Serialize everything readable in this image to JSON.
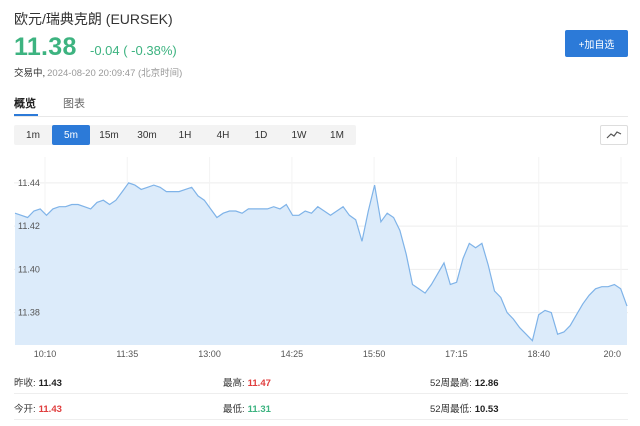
{
  "header": {
    "title": "欧元/瑞典克朗 (EURSEK)",
    "price": "11.38",
    "change": "-0.04 ( -0.38%)",
    "status": "交易中,",
    "time": "2024-08-20 20:09:47 (北京时间)",
    "watch_label": "+加自选"
  },
  "view_tabs": [
    {
      "label": "概览",
      "active": true
    },
    {
      "label": "图表",
      "active": false
    }
  ],
  "intervals": [
    {
      "label": "1m",
      "active": false
    },
    {
      "label": "5m",
      "active": true
    },
    {
      "label": "15m",
      "active": false
    },
    {
      "label": "30m",
      "active": false
    },
    {
      "label": "1H",
      "active": false
    },
    {
      "label": "4H",
      "active": false
    },
    {
      "label": "1D",
      "active": false
    },
    {
      "label": "1W",
      "active": false
    },
    {
      "label": "1M",
      "active": false
    }
  ],
  "chart_data": {
    "type": "area",
    "x_ticks": [
      "10:10",
      "11:35",
      "13:00",
      "14:25",
      "15:50",
      "17:15",
      "18:40",
      "20:0"
    ],
    "y_ticks": [
      "11.44",
      "11.42",
      "11.40",
      "11.38"
    ],
    "y_tick_values": [
      11.44,
      11.42,
      11.4,
      11.38
    ],
    "ylim": [
      11.365,
      11.452
    ],
    "grid": true,
    "line_color": "#7fb3e8",
    "fill_color": "#dcebfa",
    "values": [
      11.426,
      11.425,
      11.424,
      11.427,
      11.428,
      11.425,
      11.428,
      11.429,
      11.429,
      11.43,
      11.43,
      11.429,
      11.428,
      11.431,
      11.432,
      11.43,
      11.432,
      11.436,
      11.44,
      11.439,
      11.437,
      11.438,
      11.439,
      11.438,
      11.436,
      11.436,
      11.436,
      11.437,
      11.438,
      11.434,
      11.432,
      11.428,
      11.424,
      11.426,
      11.427,
      11.427,
      11.426,
      11.428,
      11.428,
      11.428,
      11.428,
      11.429,
      11.428,
      11.43,
      11.425,
      11.425,
      11.427,
      11.426,
      11.429,
      11.427,
      11.425,
      11.427,
      11.429,
      11.425,
      11.423,
      11.413,
      11.427,
      11.439,
      11.422,
      11.426,
      11.424,
      11.418,
      11.407,
      11.393,
      11.391,
      11.389,
      11.393,
      11.398,
      11.403,
      11.393,
      11.394,
      11.405,
      11.412,
      11.41,
      11.412,
      11.402,
      11.39,
      11.387,
      11.38,
      11.377,
      11.373,
      11.37,
      11.367,
      11.379,
      11.381,
      11.38,
      11.37,
      11.371,
      11.374,
      11.379,
      11.384,
      11.388,
      11.391,
      11.392,
      11.392,
      11.393,
      11.391,
      11.383
    ]
  },
  "stats": {
    "prev_close_label": "昨收:",
    "prev_close": "11.43",
    "high_label": "最高:",
    "high": "11.47",
    "wk52_high_label": "52周最高:",
    "wk52_high": "12.86",
    "open_label": "今开:",
    "open": "11.43",
    "low_label": "最低:",
    "low": "11.31",
    "wk52_low_label": "52周最低:",
    "wk52_low": "10.53"
  }
}
